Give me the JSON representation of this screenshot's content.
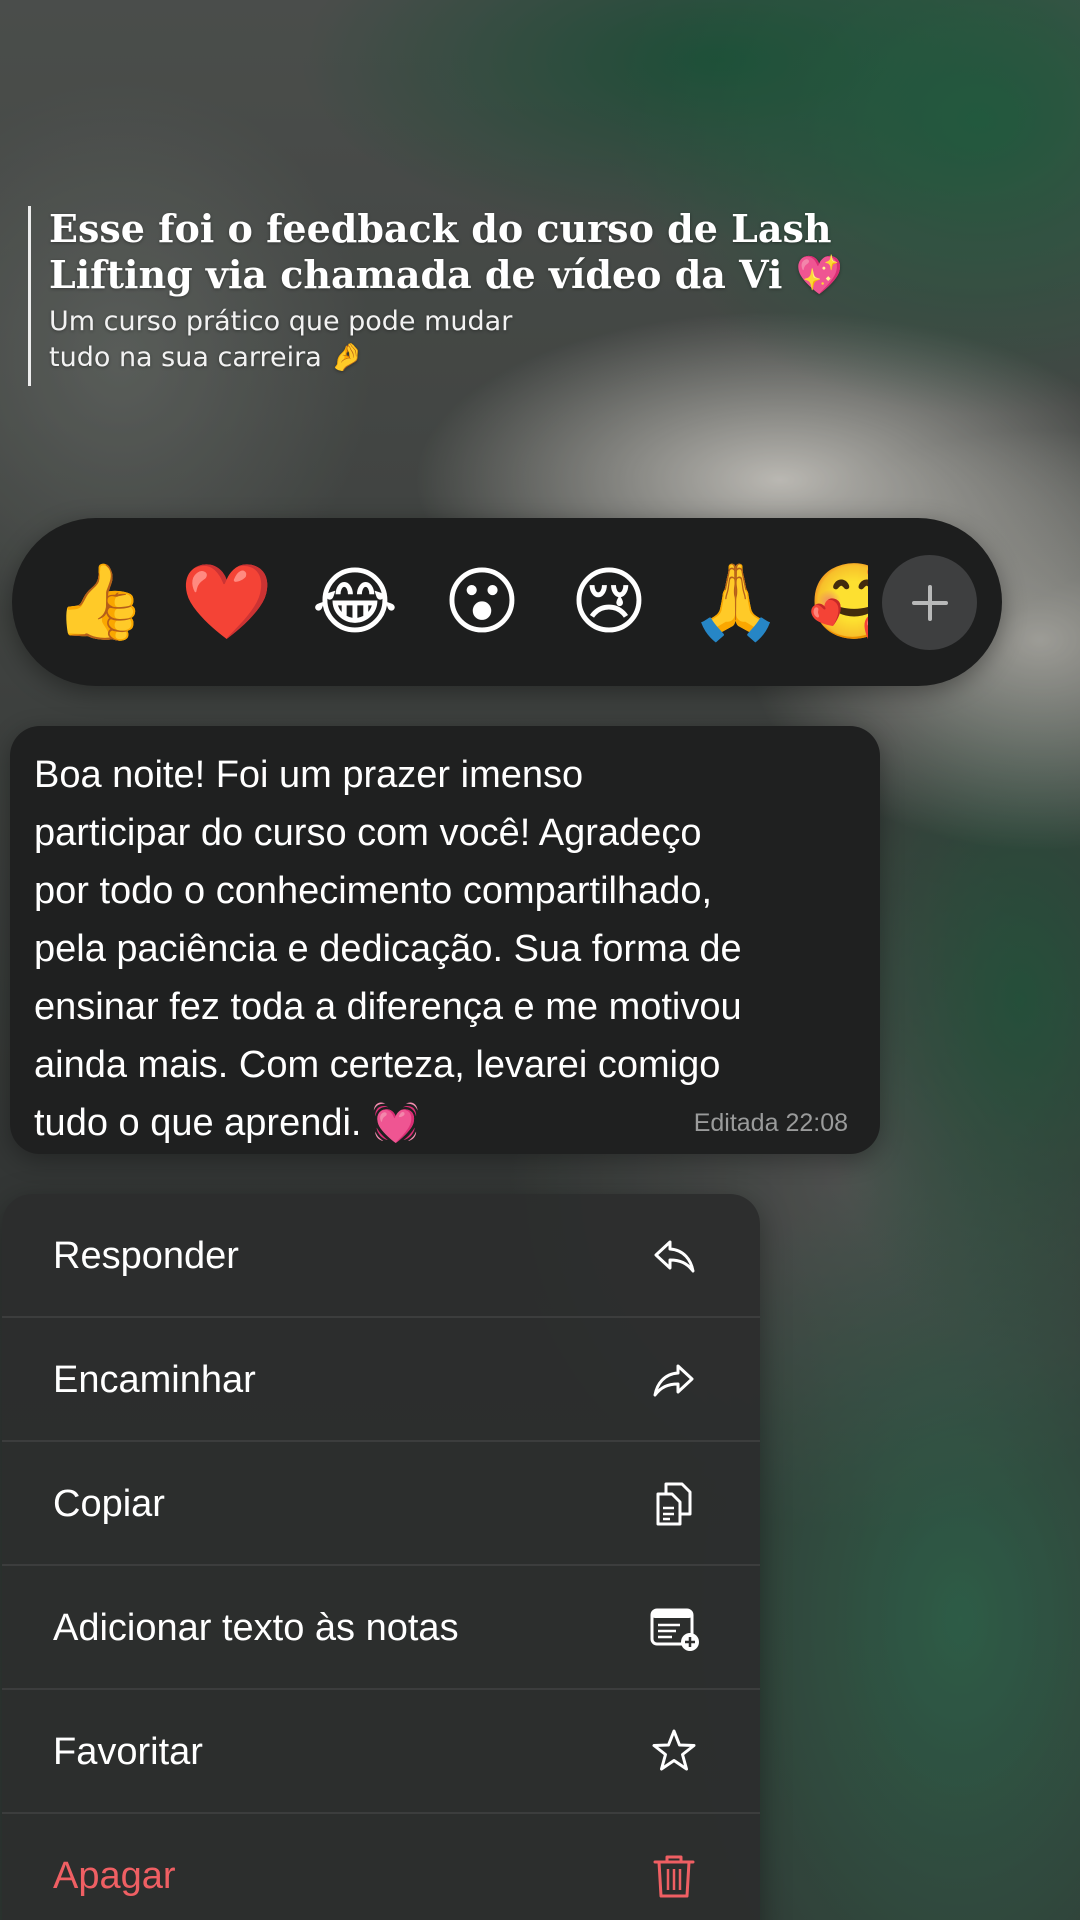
{
  "caption": {
    "title": "Esse foi o feedback do curso de Lash Lifting via chamada de vídeo da Vi 💖",
    "subtitle": "Um curso prático que pode mudar tudo na sua carreira 🤌"
  },
  "reactions": [
    {
      "emoji": "👍",
      "icon": "thumbs-up"
    },
    {
      "emoji": "❤️",
      "icon": "red-heart"
    },
    {
      "emoji": "😂",
      "icon": "tears-of-joy"
    },
    {
      "emoji": "😮",
      "icon": "open-mouth"
    },
    {
      "emoji": "😢",
      "icon": "crying-face"
    },
    {
      "emoji": "🙏",
      "icon": "folded-hands"
    },
    {
      "emoji": "🥰",
      "icon": "smiling-face-with-hearts"
    }
  ],
  "reaction_more_icon": "plus-icon",
  "message": {
    "text": "Boa noite! Foi um prazer imenso\nparticipar do curso com você! Agradeço\npor todo o conhecimento compartilhado,\npela paciência e dedicação. Sua forma de\nensinar fez toda a diferença e me motivou\nainda mais. Com certeza, levarei comigo\ntudo o que aprendi. 💓",
    "status": "Editada 22:08"
  },
  "menu": {
    "items": [
      {
        "label": "Responder",
        "icon": "reply-icon"
      },
      {
        "label": "Encaminhar",
        "icon": "forward-icon"
      },
      {
        "label": "Copiar",
        "icon": "copy-icon"
      },
      {
        "label": "Adicionar texto às notas",
        "icon": "add-note-icon"
      },
      {
        "label": "Favoritar",
        "icon": "star-icon"
      },
      {
        "label": "Apagar",
        "icon": "trash-icon"
      }
    ],
    "danger_color": "#ef5f63"
  }
}
